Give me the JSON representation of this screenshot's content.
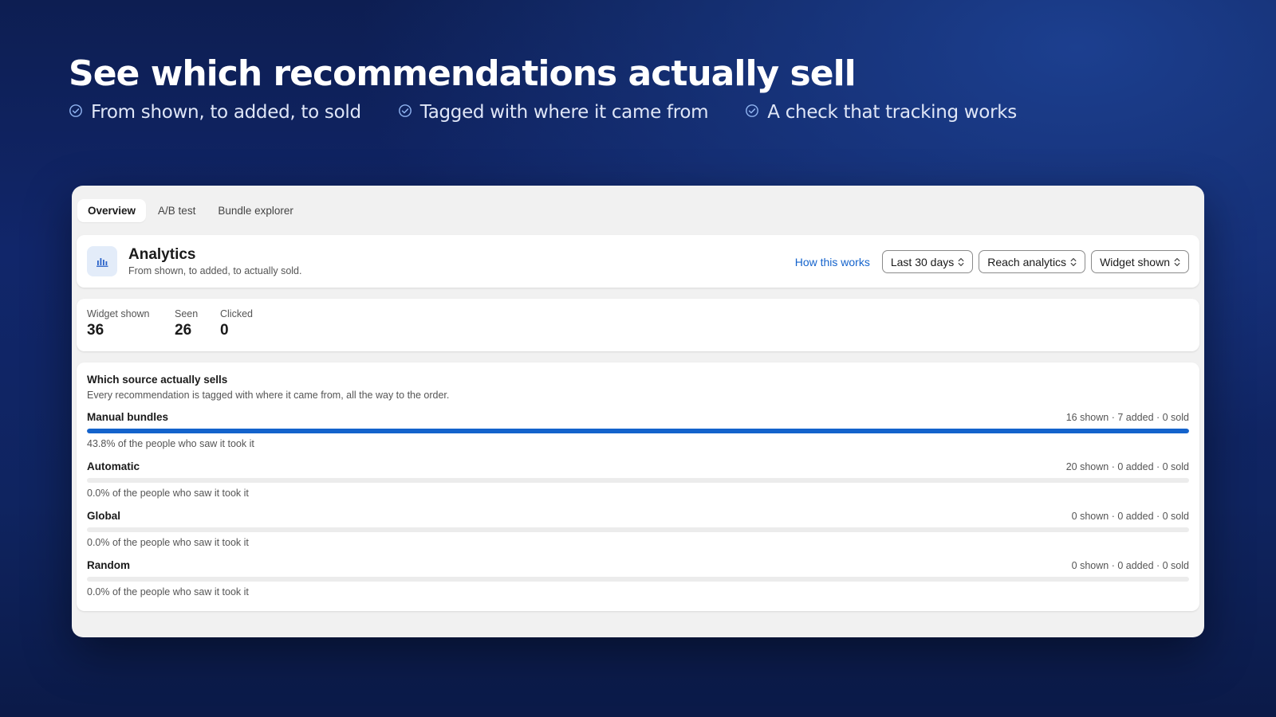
{
  "hero": {
    "title": "See which recommendations actually sell",
    "points": [
      "From shown, to added, to sold",
      "Tagged with where it came from",
      "A check that tracking works"
    ]
  },
  "tabs": [
    "Overview",
    "A/B test",
    "Bundle explorer"
  ],
  "active_tab": "Overview",
  "header": {
    "icon": "bar-chart-icon",
    "title": "Analytics",
    "subtitle": "From shown, to added, to actually sold.",
    "help_link": "How this works",
    "filters": [
      "Last 30 days",
      "Reach analytics",
      "Widget shown"
    ]
  },
  "stats": [
    {
      "label": "Widget shown",
      "value": "36"
    },
    {
      "label": "Seen",
      "value": "26"
    },
    {
      "label": "Clicked",
      "value": "0"
    }
  ],
  "sources": {
    "title": "Which source actually sells",
    "subtitle": "Every recommendation is tagged with where it came from, all the way to the order.",
    "items": [
      {
        "name": "Manual bundles",
        "counts": "16 shown · 7 added · 0 sold",
        "progress": 1.0,
        "rate": "43.8% of the people who saw it took it"
      },
      {
        "name": "Automatic",
        "counts": "20 shown · 0 added · 0 sold",
        "progress": 0,
        "rate": "0.0% of the people who saw it took it"
      },
      {
        "name": "Global",
        "counts": "0 shown · 0 added · 0 sold",
        "progress": 0,
        "rate": "0.0% of the people who saw it took it"
      },
      {
        "name": "Random",
        "counts": "0 shown · 0 added · 0 sold",
        "progress": 0,
        "rate": "0.0% of the people who saw it took it"
      }
    ]
  },
  "colors": {
    "accent": "#1463cc",
    "background": "#0f2460"
  }
}
